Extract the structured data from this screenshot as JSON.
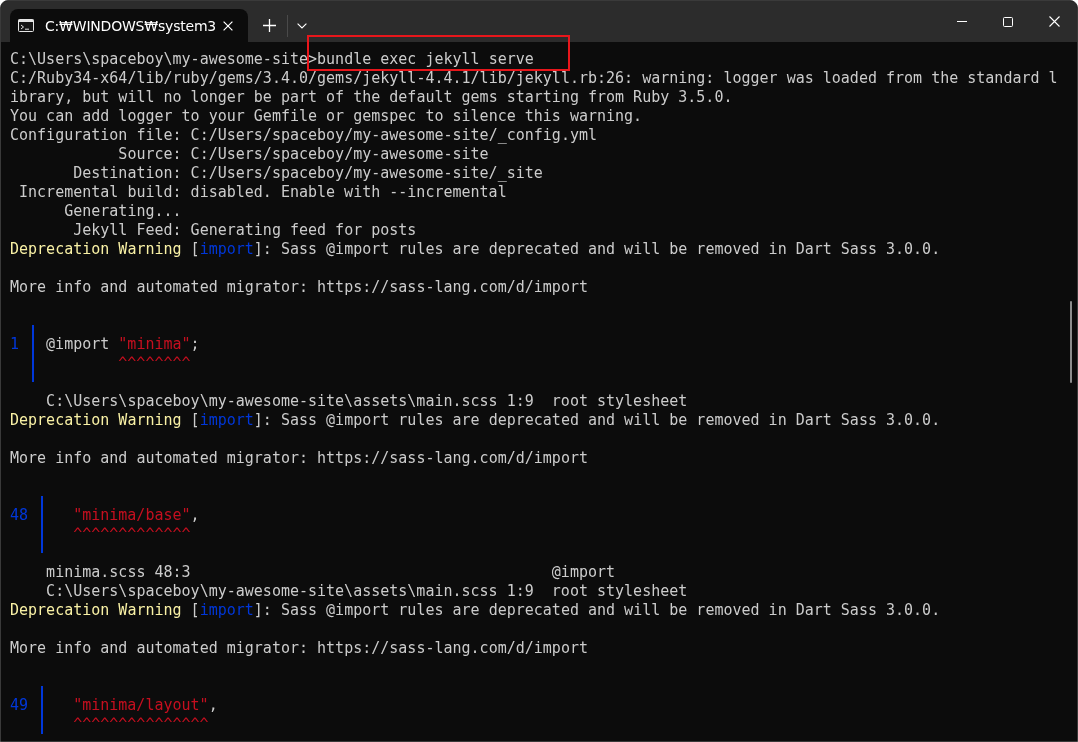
{
  "window": {
    "tabs": [
      {
        "title": "C:₩WINDOWS₩system3",
        "selected": true
      }
    ]
  },
  "lines": [
    {
      "kind": "command",
      "prompt": "C:\\Users\\spaceboy\\my-awesome-site>",
      "command": "bundle exec jekyll serve",
      "highlighted": true
    },
    {
      "kind": "text",
      "text": "C:/Ruby34-x64/lib/ruby/gems/3.4.0/gems/jekyll-4.4.1/lib/jekyll.rb:26: warning: logger was loaded from the standard l"
    },
    {
      "kind": "text",
      "text": "ibrary, but will no longer be part of the default gems starting from Ruby 3.5.0."
    },
    {
      "kind": "text",
      "text": "You can add logger to your Gemfile or gemspec to silence this warning."
    },
    {
      "kind": "text",
      "text": "Configuration file: C:/Users/spaceboy/my-awesome-site/_config.yml"
    },
    {
      "kind": "text",
      "text": "            Source: C:/Users/spaceboy/my-awesome-site"
    },
    {
      "kind": "text",
      "text": "       Destination: C:/Users/spaceboy/my-awesome-site/_site"
    },
    {
      "kind": "text",
      "text": " Incremental build: disabled. Enable with --incremental"
    },
    {
      "kind": "text",
      "text": "      Generating..."
    },
    {
      "kind": "text",
      "text": "       Jekyll Feed: Generating feed for posts"
    },
    {
      "kind": "warning",
      "segments": [
        {
          "kind": "label",
          "text": "Deprecation Warning"
        },
        {
          "kind": "plain",
          "text": " ["
        },
        {
          "kind": "tag",
          "text": "import"
        },
        {
          "kind": "plain",
          "text": "]: Sass @import rules are deprecated and will be removed in Dart Sass 3.0.0."
        }
      ]
    },
    {
      "kind": "blank"
    },
    {
      "kind": "text",
      "text": "More info and automated migrator: https://sass-lang.com/d/import"
    },
    {
      "kind": "blank"
    },
    {
      "kind": "snippet",
      "line_number": "1",
      "code": [
        {
          "kind": "plain",
          "text": "@import "
        },
        {
          "kind": "string",
          "text": "\"minima\""
        },
        {
          "kind": "plain",
          "text": ";"
        }
      ],
      "marker": "        ^^^^^^^^",
      "closed": true
    },
    {
      "kind": "trace",
      "frames": [
        {
          "location": "C:\\Users\\spaceboy\\my-awesome-site\\assets\\main.scss 1:9",
          "member": "root stylesheet"
        }
      ]
    },
    {
      "kind": "warning",
      "segments": [
        {
          "kind": "label",
          "text": "Deprecation Warning"
        },
        {
          "kind": "plain",
          "text": " ["
        },
        {
          "kind": "tag",
          "text": "import"
        },
        {
          "kind": "plain",
          "text": "]: Sass @import rules are deprecated and will be removed in Dart Sass 3.0.0."
        }
      ]
    },
    {
      "kind": "blank"
    },
    {
      "kind": "text",
      "text": "More info and automated migrator: https://sass-lang.com/d/import"
    },
    {
      "kind": "blank"
    },
    {
      "kind": "snippet",
      "line_number": "48",
      "code": [
        {
          "kind": "string",
          "text": "  \"minima/base\""
        },
        {
          "kind": "plain",
          "text": ","
        }
      ],
      "marker": "  ^^^^^^^^^^^^^",
      "closed": true
    },
    {
      "kind": "trace",
      "frames": [
        {
          "location": "minima.scss 48:3",
          "member": "@import"
        },
        {
          "location": "C:\\Users\\spaceboy\\my-awesome-site\\assets\\main.scss 1:9",
          "member": "root stylesheet"
        }
      ]
    },
    {
      "kind": "warning",
      "segments": [
        {
          "kind": "label",
          "text": "Deprecation Warning"
        },
        {
          "kind": "plain",
          "text": " ["
        },
        {
          "kind": "tag",
          "text": "import"
        },
        {
          "kind": "plain",
          "text": "]: Sass @import rules are deprecated and will be removed in Dart Sass 3.0.0."
        }
      ]
    },
    {
      "kind": "blank"
    },
    {
      "kind": "text",
      "text": "More info and automated migrator: https://sass-lang.com/d/import"
    },
    {
      "kind": "blank"
    },
    {
      "kind": "snippet",
      "line_number": "49",
      "code": [
        {
          "kind": "string",
          "text": "  \"minima/layout\""
        },
        {
          "kind": "plain",
          "text": ","
        }
      ],
      "marker": "  ^^^^^^^^^^^^^^^",
      "closed": false
    }
  ]
}
